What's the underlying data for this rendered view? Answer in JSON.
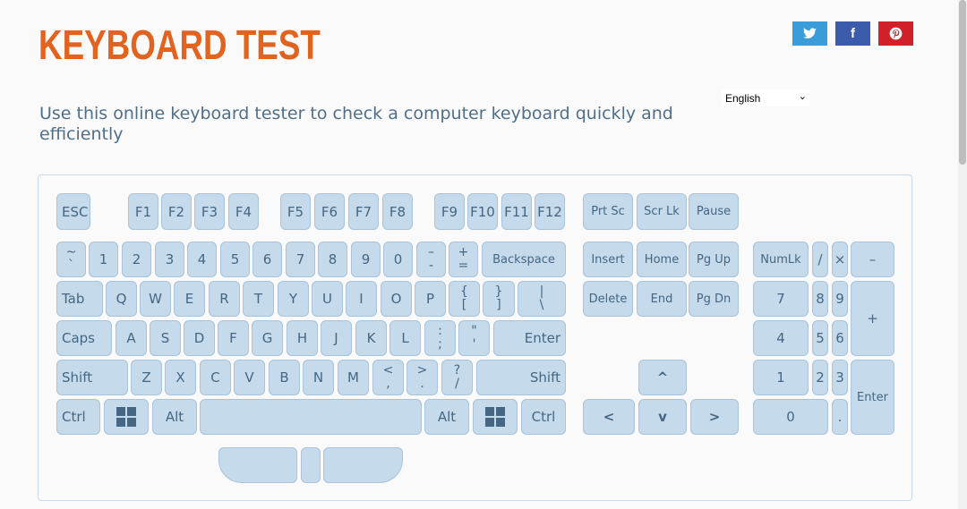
{
  "header": {
    "title": "KEYBOARD TEST",
    "subtitle": "Use this online keyboard tester to check a computer keyboard quickly and efficiently"
  },
  "share": {
    "twitter_icon": "twitter-icon",
    "facebook_icon": "facebook-icon",
    "pinterest_icon": "pinterest-icon"
  },
  "language": {
    "selected": "English"
  },
  "colors": {
    "title": "#e2621f",
    "key_bg": "#c5daea",
    "key_text": "#456783"
  },
  "keyboard": {
    "function_row": [
      "ESC",
      "F1",
      "F2",
      "F3",
      "F4",
      "F5",
      "F6",
      "F7",
      "F8",
      "F9",
      "F10",
      "F11",
      "F12"
    ],
    "nav_top": [
      "Prt Sc",
      "Scr Lk",
      "Pause"
    ],
    "number_row": [
      {
        "top": "~",
        "bottom": "`"
      },
      {
        "label": "1"
      },
      {
        "label": "2"
      },
      {
        "label": "3"
      },
      {
        "label": "4"
      },
      {
        "label": "5"
      },
      {
        "label": "6"
      },
      {
        "label": "7"
      },
      {
        "label": "8"
      },
      {
        "label": "9"
      },
      {
        "label": "0"
      },
      {
        "top": "–",
        "bottom": "-"
      },
      {
        "top": "+",
        "bottom": "="
      },
      {
        "label": "Backspace"
      }
    ],
    "tab_row": [
      {
        "label": "Tab"
      },
      {
        "label": "Q"
      },
      {
        "label": "W"
      },
      {
        "label": "E"
      },
      {
        "label": "R"
      },
      {
        "label": "T"
      },
      {
        "label": "Y"
      },
      {
        "label": "U"
      },
      {
        "label": "I"
      },
      {
        "label": "O"
      },
      {
        "label": "P"
      },
      {
        "top": "{",
        "bottom": "["
      },
      {
        "top": "}",
        "bottom": "]"
      },
      {
        "top": "|",
        "bottom": "\\"
      }
    ],
    "caps_row": [
      {
        "label": "Caps"
      },
      {
        "label": "A"
      },
      {
        "label": "S"
      },
      {
        "label": "D"
      },
      {
        "label": "F"
      },
      {
        "label": "G"
      },
      {
        "label": "H"
      },
      {
        "label": "J"
      },
      {
        "label": "K"
      },
      {
        "label": "L"
      },
      {
        "top": ":",
        "bottom": ";"
      },
      {
        "top": "\"",
        "bottom": "'"
      },
      {
        "label": "Enter"
      }
    ],
    "shift_row": [
      {
        "label": "Shift"
      },
      {
        "label": "Z"
      },
      {
        "label": "X"
      },
      {
        "label": "C"
      },
      {
        "label": "V"
      },
      {
        "label": "B"
      },
      {
        "label": "N"
      },
      {
        "label": "M"
      },
      {
        "top": "<",
        "bottom": ","
      },
      {
        "top": ">",
        "bottom": "."
      },
      {
        "top": "?",
        "bottom": "/"
      },
      {
        "label": "Shift"
      }
    ],
    "bottom_row": {
      "ctrl_left": "Ctrl",
      "alt_left": "Alt",
      "alt_right": "Alt",
      "ctrl_right": "Ctrl",
      "win_icon": "windows-icon"
    },
    "nav_block": [
      "Insert",
      "Home",
      "Pg Up",
      "Delete",
      "End",
      "Pg Dn"
    ],
    "arrows": {
      "up": "^",
      "left": "<",
      "down": "v",
      "right": ">"
    },
    "numpad": {
      "numlk": "NumLk",
      "divide": "/",
      "multiply": "×",
      "minus": "–",
      "plus": "+",
      "n7": "7",
      "n8": "8",
      "n9": "9",
      "n4": "4",
      "n5": "5",
      "n6": "6",
      "n1": "1",
      "n2": "2",
      "n3": "3",
      "n0": "0",
      "dot": ".",
      "enter": "Enter"
    }
  }
}
